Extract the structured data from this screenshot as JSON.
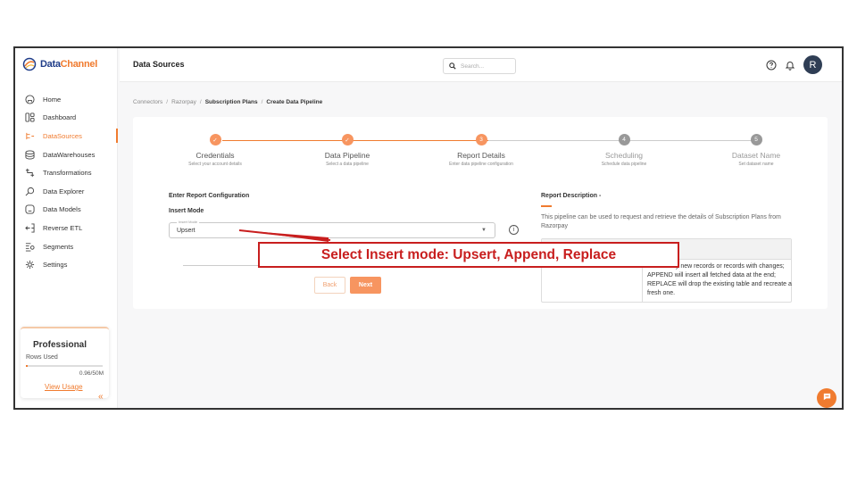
{
  "app": {
    "logo_prefix": "Data",
    "logo_suffix": "Channel"
  },
  "sidebar": {
    "items": [
      {
        "label": "Home",
        "icon": "home-icon",
        "active": false
      },
      {
        "label": "Dashboard",
        "icon": "dashboard-icon",
        "active": false
      },
      {
        "label": "DataSources",
        "icon": "datasources-icon",
        "active": true
      },
      {
        "label": "DataWarehouses",
        "icon": "database-icon",
        "active": false
      },
      {
        "label": "Transformations",
        "icon": "transform-icon",
        "active": false
      },
      {
        "label": "Data Explorer",
        "icon": "explorer-icon",
        "active": false
      },
      {
        "label": "Data Models",
        "icon": "models-icon",
        "active": false
      },
      {
        "label": "Reverse ETL",
        "icon": "reverse-etl-icon",
        "active": false
      },
      {
        "label": "Segments",
        "icon": "segments-icon",
        "active": false
      },
      {
        "label": "Settings",
        "icon": "settings-icon",
        "active": false
      }
    ],
    "plan": {
      "title": "Professional",
      "rows_label": "Rows Used",
      "usage": "0.96/50M",
      "usage_fraction": 0.02,
      "link": "View Usage"
    },
    "collapse_glyph": "«"
  },
  "header": {
    "title": "Data Sources",
    "search_placeholder": "Search...",
    "avatar_initial": "R"
  },
  "breadcrumb": {
    "items": [
      "Connectors",
      "Razorpay",
      "Subscription Plans",
      "Create Data Pipeline"
    ]
  },
  "stepper": {
    "steps": [
      {
        "title": "Credentials",
        "sub": "Select your account details",
        "marker": "✓",
        "state": "done"
      },
      {
        "title": "Data Pipeline",
        "sub": "Select a data pipeline",
        "marker": "✓",
        "state": "done"
      },
      {
        "title": "Report Details",
        "sub": "Enter data pipeline configuration",
        "marker": "3",
        "state": "current"
      },
      {
        "title": "Scheduling",
        "sub": "Schedule data pipeline",
        "marker": "4",
        "state": "todo"
      },
      {
        "title": "Dataset Name",
        "sub": "Set dataset name",
        "marker": "5",
        "state": "todo"
      }
    ]
  },
  "form": {
    "section_title": "Enter Report Configuration",
    "insert_mode_label": "Insert Mode",
    "select_floating_label": "Insert Mode",
    "select_value": "Upsert",
    "back_label": "Back",
    "next_label": "Next"
  },
  "description": {
    "title": "Report Description -",
    "text": "This pipeline can be used to request and retrieve the details of Subscription Plans from Razorpay",
    "cell_text": "l insert only new records or records with changes; APPEND will insert all fetched data at the end; REPLACE will drop the existing table and recreate a fresh one."
  },
  "annotation": {
    "callout": "Select Insert mode: Upsert, Append, Replace"
  },
  "colors": {
    "accent": "#f07b2f",
    "annotation": "#c81e1e",
    "brand_blue": "#1f3c88"
  }
}
